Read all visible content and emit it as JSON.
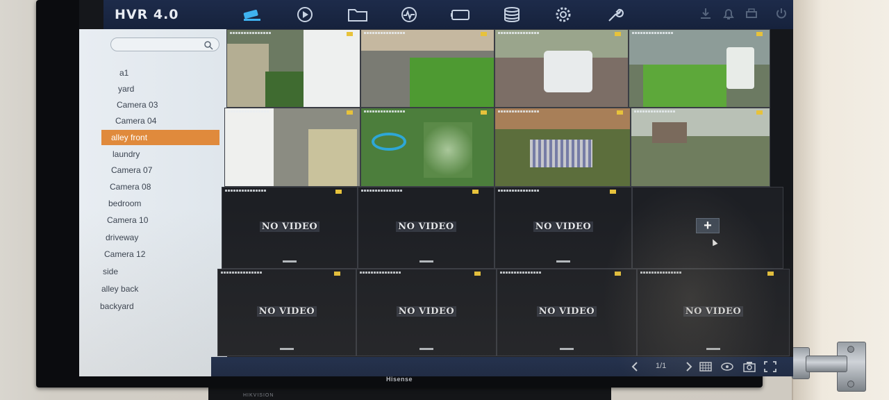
{
  "app": {
    "title": "HVR 4.0",
    "tv_brand": "Hisense",
    "stand_brand": "HIKVISION"
  },
  "topbar": {
    "nav": [
      {
        "name": "live-view-icon"
      },
      {
        "name": "playback-icon"
      },
      {
        "name": "files-icon"
      },
      {
        "name": "smart-analysis-icon"
      },
      {
        "name": "camera-setup-icon"
      },
      {
        "name": "storage-icon"
      },
      {
        "name": "settings-gear-icon"
      },
      {
        "name": "maintenance-wrench-icon"
      }
    ],
    "right": [
      {
        "name": "download-icon"
      },
      {
        "name": "alarm-bell-icon"
      },
      {
        "name": "print-icon"
      },
      {
        "name": "power-icon"
      }
    ]
  },
  "sidebar": {
    "search_placeholder": "",
    "channels": [
      {
        "label": "a1",
        "active": false
      },
      {
        "label": "yard",
        "active": false
      },
      {
        "label": "Camera 03",
        "active": false
      },
      {
        "label": "Camera 04",
        "active": false
      },
      {
        "label": "alley front",
        "active": true
      },
      {
        "label": "laundry",
        "active": false
      },
      {
        "label": "Camera 07",
        "active": false
      },
      {
        "label": "Camera 08",
        "active": false
      },
      {
        "label": "bedroom",
        "active": false
      },
      {
        "label": "Camera 10",
        "active": false
      },
      {
        "label": "driveway",
        "active": false
      },
      {
        "label": "Camera 12",
        "active": false
      },
      {
        "label": "side",
        "active": false
      },
      {
        "label": "alley back",
        "active": false
      },
      {
        "label": "backyard",
        "active": false
      }
    ]
  },
  "grid": {
    "no_video_label": "NO VIDEO",
    "tiles": [
      {
        "status": "live"
      },
      {
        "status": "live"
      },
      {
        "status": "live"
      },
      {
        "status": "live"
      },
      {
        "status": "live"
      },
      {
        "status": "live"
      },
      {
        "status": "live"
      },
      {
        "status": "live"
      },
      {
        "status": "no-video"
      },
      {
        "status": "no-video"
      },
      {
        "status": "no-video"
      },
      {
        "status": "add"
      },
      {
        "status": "no-video"
      },
      {
        "status": "no-video"
      },
      {
        "status": "no-video"
      },
      {
        "status": "no-video"
      }
    ]
  },
  "bottombar": {
    "page_indicator": "1/1"
  },
  "colors": {
    "topbar": "#1d2b4a",
    "sidebar": "#e8edf2",
    "active_channel": "#e08a3c",
    "tile_empty": "#1d1f24"
  }
}
